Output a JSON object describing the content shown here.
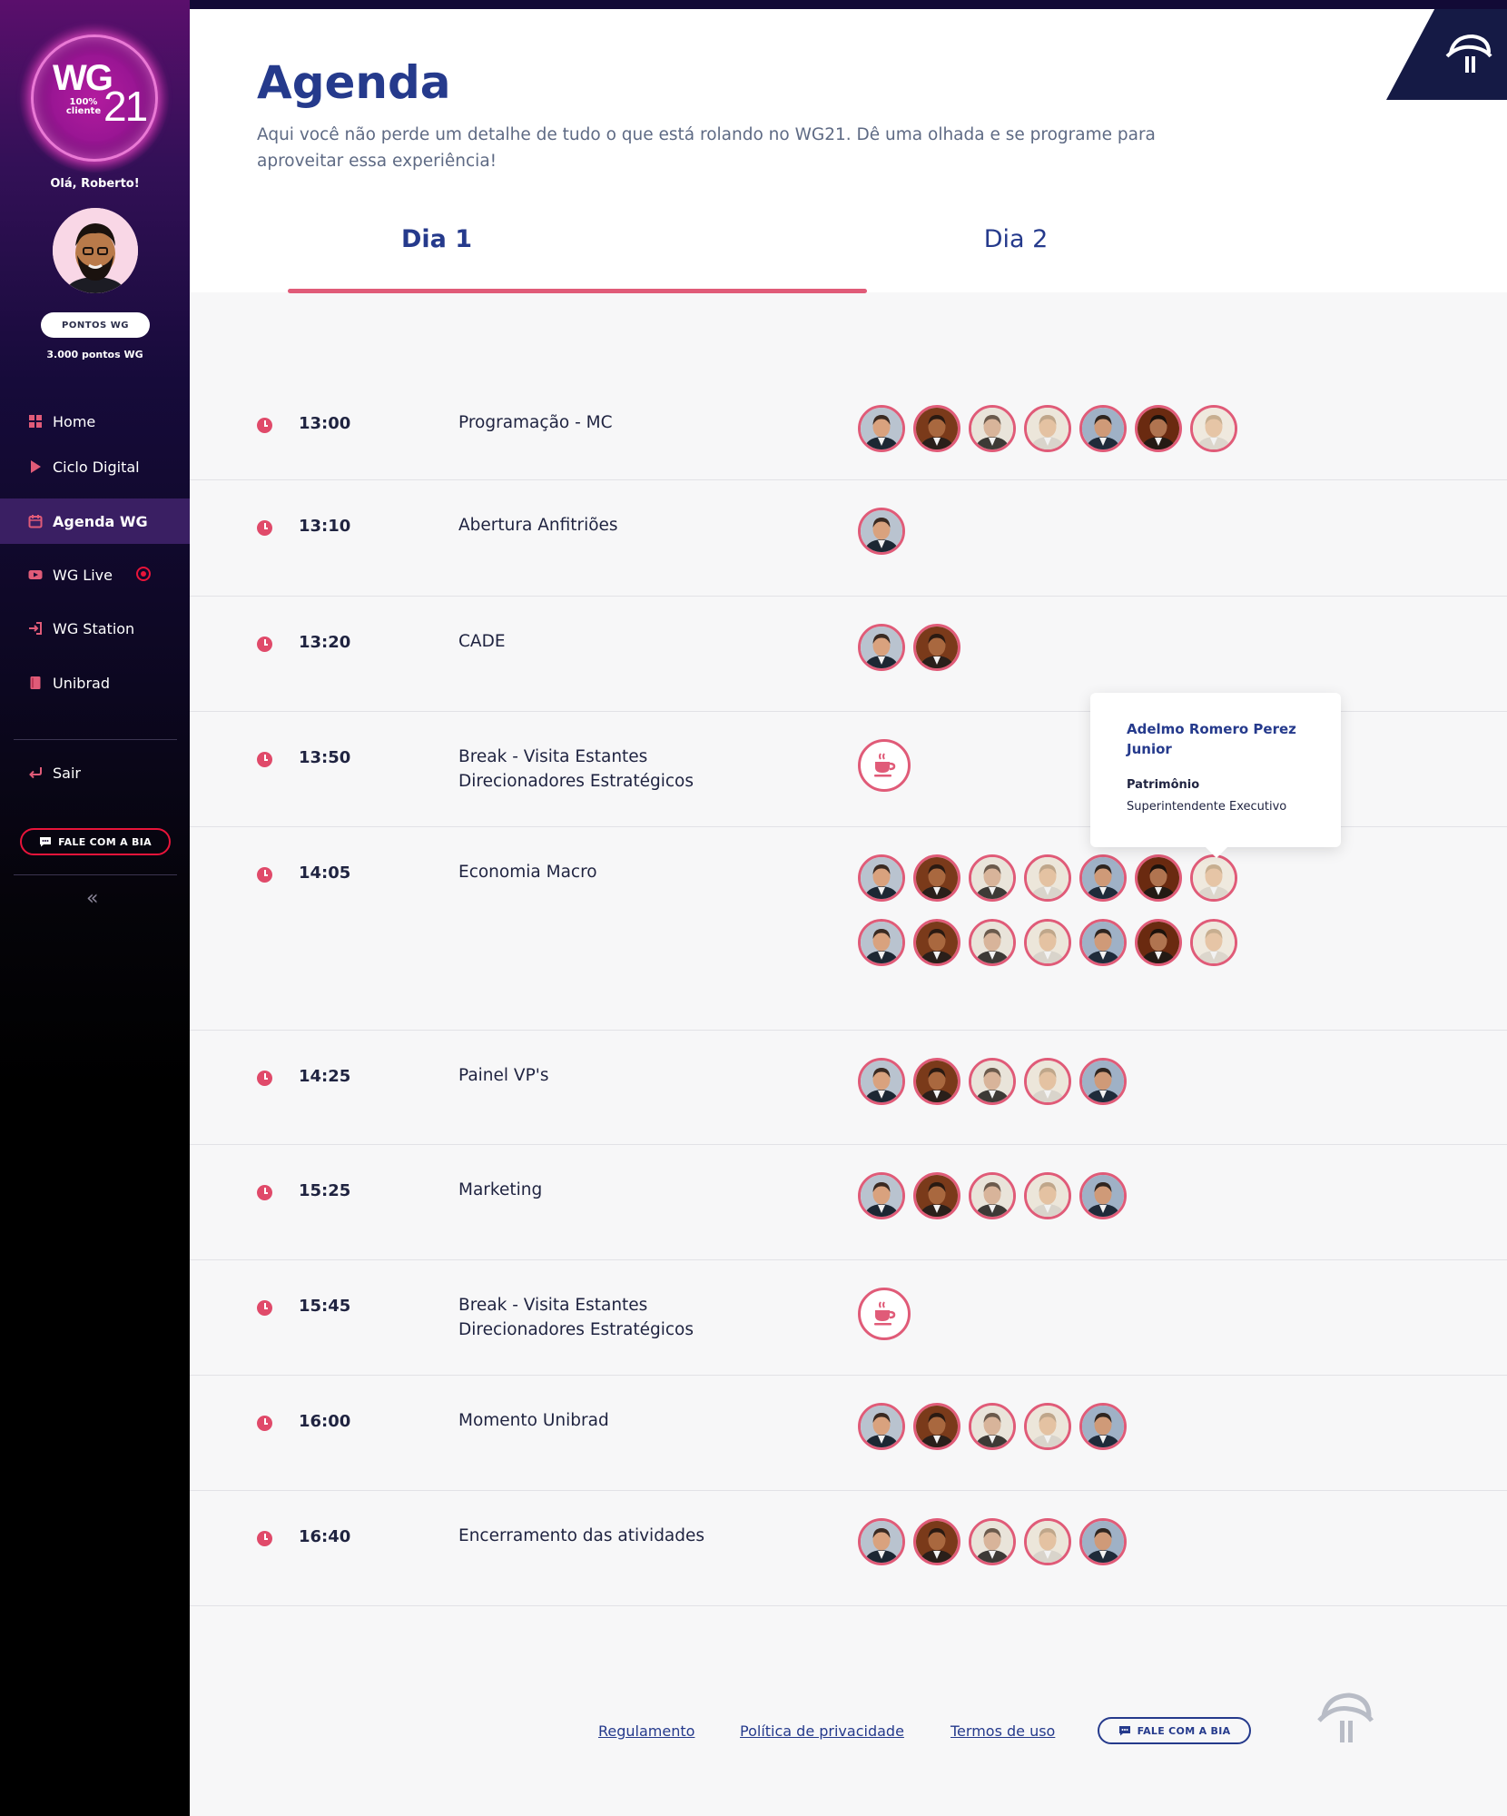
{
  "sidebar": {
    "logo": {
      "wg": "WG",
      "tag": "100% cliente",
      "num": "21"
    },
    "greeting": "Olá, Roberto!",
    "points_button": "PONTOS WG",
    "points_value": "3.000 pontos WG",
    "items": [
      {
        "label": "Home",
        "icon": "grid-icon"
      },
      {
        "label": "Ciclo Digital",
        "icon": "play-icon"
      },
      {
        "label": "Agenda WG",
        "icon": "calendar-icon",
        "active": true
      },
      {
        "label": "WG Live",
        "icon": "video-icon",
        "live": true
      },
      {
        "label": "WG Station",
        "icon": "enter-icon"
      },
      {
        "label": "Unibrad",
        "icon": "book-icon"
      }
    ],
    "logout": "Sair",
    "chat_button": "FALE COM A BIA"
  },
  "header": {
    "title": "Agenda",
    "description": "Aqui você não perde um detalhe de tudo o que está rolando no WG21. Dê uma olhada e se programe para aproveitar essa experiência!",
    "tabs": [
      "Dia 1",
      "Dia 2"
    ],
    "active_tab": "Dia 1"
  },
  "schedule": [
    {
      "time": "13:00",
      "title": "Programação - MC",
      "speakers": 7
    },
    {
      "time": "13:10",
      "title": "Abertura Anfitriões",
      "speakers": 1
    },
    {
      "time": "13:20",
      "title": "CADE",
      "speakers": 2
    },
    {
      "time": "13:50",
      "title": "Break - Visita Estantes Direcionadores Estratégicos",
      "title_lines": [
        "Break - Visita Estantes",
        "Direcionadores Estratégicos"
      ],
      "coffee": true
    },
    {
      "time": "14:05",
      "title": "Economia Macro",
      "speakers": 14
    },
    {
      "time": "14:25",
      "title": "Painel VP's",
      "speakers": 5
    },
    {
      "time": "15:25",
      "title": "Marketing",
      "speakers": 5
    },
    {
      "time": "15:45",
      "title": "Break - Visita Estantes Direcionadores Estratégicos",
      "title_lines": [
        "Break - Visita Estantes",
        "Direcionadores Estratégicos"
      ],
      "coffee": true
    },
    {
      "time": "16:00",
      "title": "Momento Unibrad",
      "speakers": 5
    },
    {
      "time": "16:40",
      "title": "Encerramento das atividades",
      "speakers": 5
    }
  ],
  "tooltip": {
    "name": "Adelmo Romero Perez Junior",
    "department": "Patrimônio",
    "role": "Superintendente Executivo"
  },
  "footer": {
    "links": [
      "Regulamento",
      "Política de privacidade",
      "Termos de uso"
    ],
    "chat_button": "FALE COM A BIA"
  },
  "colors": {
    "accent": "#e05b78",
    "brand": "#253a8c",
    "live": "#e8143a",
    "dark": "#151a45"
  }
}
